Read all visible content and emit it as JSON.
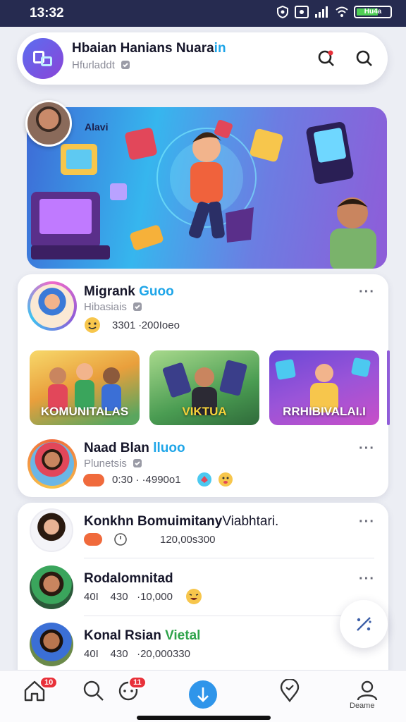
{
  "status_bar": {
    "time": "13:32",
    "battery": "Hu4a"
  },
  "header": {
    "title_main": "Hbaian Hanians Nuara",
    "title_accent": "in",
    "subtitle": "Hfurladdt"
  },
  "hero": {
    "label": "Alavi"
  },
  "group": {
    "post1": {
      "title_main": "Migrank ",
      "title_accent": "Guoo",
      "subtitle": "Hibasiais",
      "stats": "3301  ∙200Ioeo"
    },
    "tiles": [
      {
        "label": "KOMUNITALAS"
      },
      {
        "label": "VIKTUA"
      },
      {
        "label": "RRHIBIVALAI.I"
      }
    ],
    "post2": {
      "title_main": "Naad Blan ",
      "title_accent": "lluoo",
      "subtitle": "Plunetsis",
      "stats": "0:30 · ·4990o1"
    }
  },
  "list": {
    "items": [
      {
        "title": "Konkhn Bomuimitany",
        "title_tail": "Viabhtari.",
        "stats": "120,00s300"
      },
      {
        "title": "Rodalomnitad",
        "stats_a": "40I",
        "stats_b": "430",
        "stats_c": "·10,000"
      },
      {
        "title_main": "Konal Rsian ",
        "title_accent": "Vietal",
        "stats_a": "40I",
        "stats_b": "430",
        "stats_c": "·20,000330"
      }
    ]
  },
  "nav": {
    "home_badge": "10",
    "chat_badge": "11",
    "profile_label": "Deame"
  },
  "colors": {
    "accent": "#1ea5e8",
    "status_bar": "#262b50",
    "nav_center": "#2f95ea",
    "badge": "#e8313a"
  }
}
